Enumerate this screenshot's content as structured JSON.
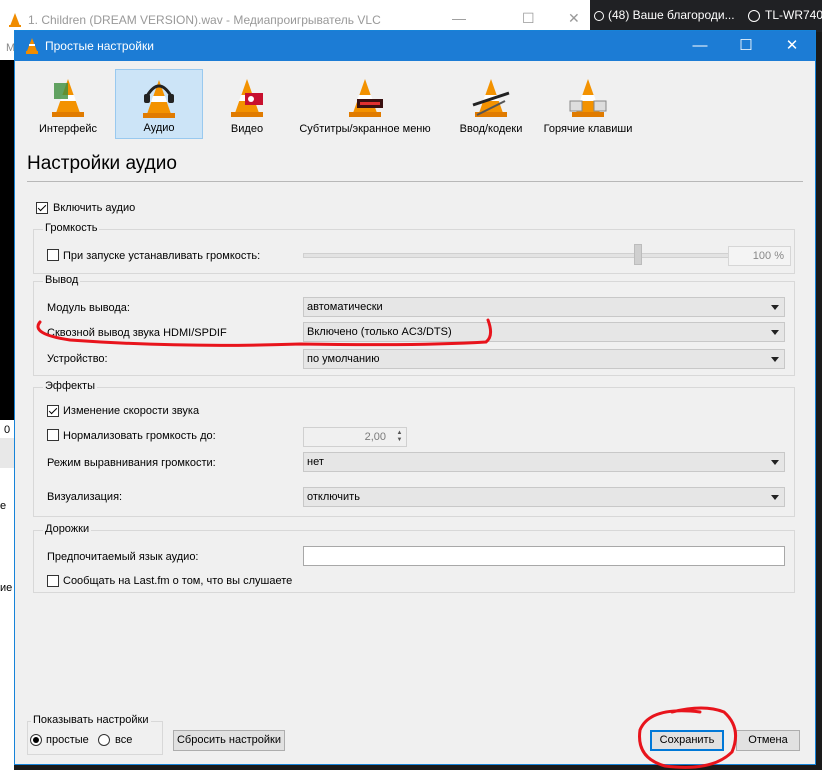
{
  "background_window": {
    "title": "1. Children (DREAM VERSION).wav - Медиапроигрыватель VLC",
    "left_fragment_top": "М",
    "left_fragment_mid": "0",
    "left_fragment_low": "е",
    "left_fragment_bottom": "ие"
  },
  "browser_tabs": [
    {
      "label": "(48) Ваше благороди..."
    },
    {
      "label": "TL-WR740"
    }
  ],
  "dialog": {
    "title": "Простые настройки",
    "minimize": "—",
    "maximize": "☐",
    "close": "✕"
  },
  "categories": [
    {
      "label": "Интерфейс",
      "icon": "interface-cone-icon"
    },
    {
      "label": "Аудио",
      "icon": "audio-headset-cone-icon",
      "active": true
    },
    {
      "label": "Видео",
      "icon": "video-cone-icon"
    },
    {
      "label": "Субтитры/экранное меню",
      "icon": "subtitles-cone-icon"
    },
    {
      "label": "Ввод/кодеки",
      "icon": "codecs-cone-icon"
    },
    {
      "label": "Горячие клавиши",
      "icon": "hotkeys-cone-icon"
    }
  ],
  "section_title": "Настройки аудио",
  "enable_audio": {
    "label": "Включить аудио",
    "checked": true
  },
  "volume_group": {
    "title": "Громкость",
    "startup_volume_label": "При запуске устанавливать громкость:",
    "startup_volume_checked": false,
    "slider_level": 0.84,
    "value": "100 %"
  },
  "output_group": {
    "title": "Вывод",
    "module_label": "Модуль вывода:",
    "module_value": "автоматически",
    "spdif_label": "Сквозной вывод звука HDMI/SPDIF",
    "spdif_value": "Включено (только AC3/DTS)",
    "device_label": "Устройство:",
    "device_value": "по умолчанию"
  },
  "effects_group": {
    "title": "Эффекты",
    "time_stretch_label": "Изменение скорости звука",
    "time_stretch_checked": true,
    "normalize_label": "Нормализовать громкость до:",
    "normalize_checked": false,
    "normalize_value": "2,00",
    "replay_gain_label": "Режим выравнивания громкости:",
    "replay_gain_value": "нет",
    "visualization_label": "Визуализация:",
    "visualization_value": "отключить"
  },
  "tracks_group": {
    "title": "Дорожки",
    "preferred_lang_label": "Предпочитаемый язык аудио:",
    "preferred_lang_value": "",
    "lastfm_label": "Сообщать на Last.fm о том, что вы слушаете",
    "lastfm_checked": false
  },
  "show_settings": {
    "title": "Показывать настройки",
    "simple_label": "простые",
    "all_label": "все",
    "selected": "простые"
  },
  "buttons": {
    "reset": "Сбросить настройки",
    "save": "Сохранить",
    "cancel": "Отмена"
  },
  "colors": {
    "titlebar": "#1c7cd5",
    "annotation": "#e8141c",
    "active_category": "#cce4f7"
  }
}
